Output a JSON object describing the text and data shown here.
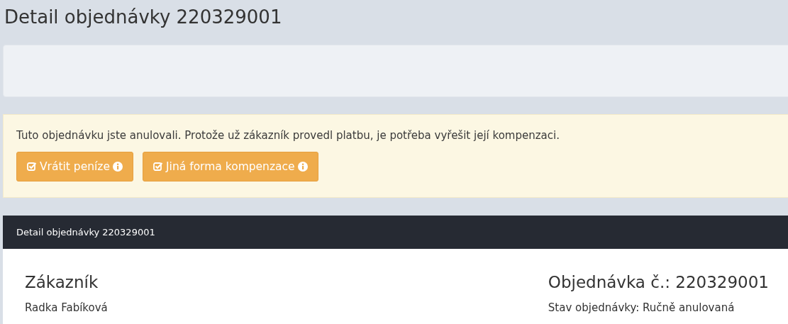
{
  "page_title": "Detail objednávky 220329001",
  "alert": {
    "message": "Tuto objednávku jste anulovali. Protože už zákazník provedl platbu, je potřeba vyřešit její kompenzaci.",
    "buttons": [
      {
        "label": "Vrátit peníze"
      },
      {
        "label": "Jiná forma kompenzace"
      }
    ]
  },
  "card": {
    "header": "Detail objednávky 220329001",
    "customer": {
      "heading": "Zákazník",
      "name": "Radka Fabíková"
    },
    "order": {
      "heading": "Objednávka č.: 220329001",
      "status": "Stav objednávky: Ručně anulovaná"
    }
  }
}
